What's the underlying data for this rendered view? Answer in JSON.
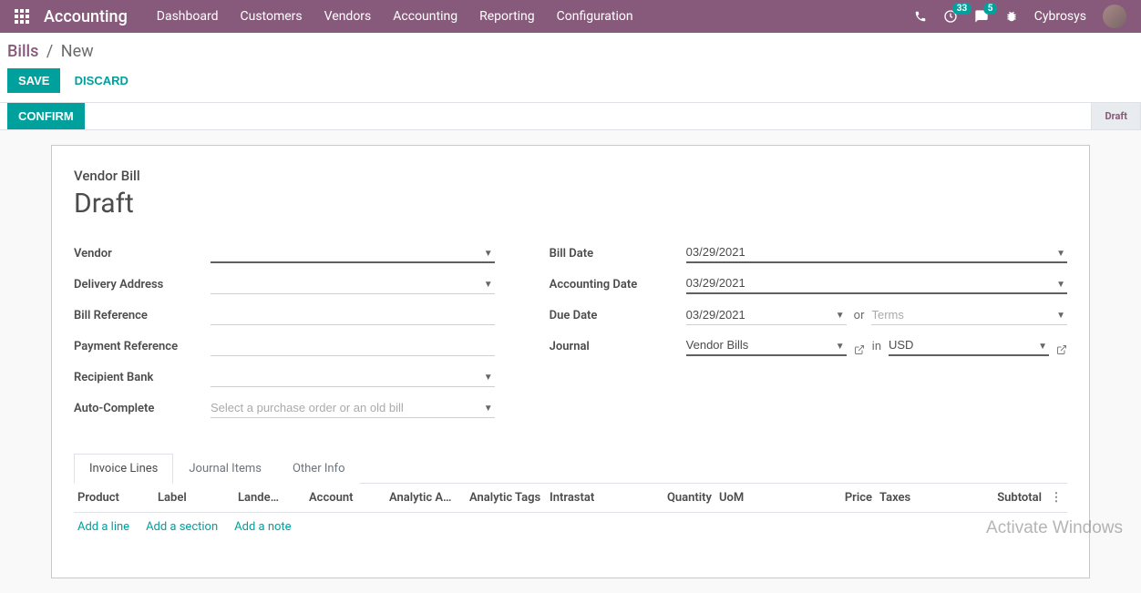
{
  "topbar": {
    "brand": "Accounting",
    "menu": [
      "Dashboard",
      "Customers",
      "Vendors",
      "Accounting",
      "Reporting",
      "Configuration"
    ],
    "clock_badge": "33",
    "chat_badge": "5",
    "username": "Cybrosys"
  },
  "breadcrumb": {
    "parent": "Bills",
    "current": "New"
  },
  "actions": {
    "save": "Save",
    "discard": "Discard"
  },
  "status": {
    "confirm": "Confirm",
    "stage": "Draft"
  },
  "sheet": {
    "subtitle": "Vendor Bill",
    "title": "Draft",
    "left": {
      "vendor_label": "Vendor",
      "vendor": "",
      "delivery_label": "Delivery Address",
      "delivery": "",
      "billref_label": "Bill Reference",
      "billref": "",
      "payref_label": "Payment Reference",
      "payref": "",
      "bank_label": "Recipient Bank",
      "bank": "",
      "auto_label": "Auto-Complete",
      "auto_placeholder": "Select a purchase order or an old bill"
    },
    "right": {
      "billdate_label": "Bill Date",
      "billdate": "03/29/2021",
      "accdate_label": "Accounting Date",
      "accdate": "03/29/2021",
      "duedate_label": "Due Date",
      "duedate": "03/29/2021",
      "or": "or",
      "terms_placeholder": "Terms",
      "journal_label": "Journal",
      "journal": "Vendor Bills",
      "in": "in",
      "currency": "USD"
    },
    "tabs": [
      "Invoice Lines",
      "Journal Items",
      "Other Info"
    ],
    "columns": [
      "Product",
      "Label",
      "Lande…",
      "Account",
      "Analytic A…",
      "Analytic Tags",
      "Intrastat",
      "Quantity",
      "UoM",
      "Price",
      "Taxes",
      "Subtotal"
    ],
    "grid_actions": [
      "Add a line",
      "Add a section",
      "Add a note"
    ]
  },
  "watermark": "Activate Windows"
}
